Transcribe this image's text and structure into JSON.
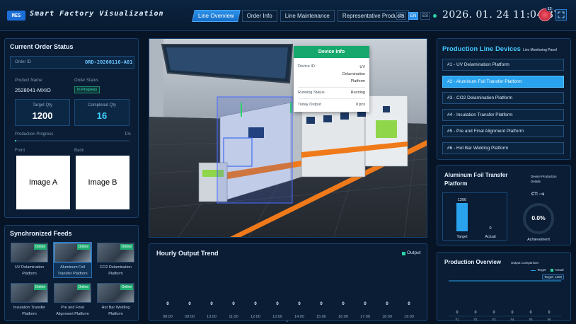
{
  "header": {
    "logo": "MES",
    "title": "Smart Factory Visualization",
    "tabs": [
      {
        "label": "Line Overview",
        "active": true
      },
      {
        "label": "Order Info",
        "active": false
      },
      {
        "label": "Line Maintenance",
        "active": false
      },
      {
        "label": "Representative Products",
        "active": false
      }
    ],
    "languages": [
      {
        "code": "CN",
        "active": false
      },
      {
        "code": "EN",
        "active": true
      },
      {
        "code": "ES",
        "active": false
      }
    ],
    "clock": "2026. 01. 24  11:04:37",
    "alert_count": "12",
    "fullscreen_icon": "expand-icon"
  },
  "order": {
    "title": "Current Order Status",
    "order_id_label": "Order ID",
    "order_id": "ORD-20260116-A01",
    "product_name_label": "Product Name",
    "product_name": "2528041-MXIO",
    "order_status_label": "Order Status",
    "order_status": "In Progress",
    "target_qty_label": "Target Qty",
    "target_qty": "1200",
    "completed_qty_label": "Completed Qty",
    "completed_qty": "16",
    "progress_label": "Production Progress",
    "progress_text": "1%",
    "progress_fraction": 0.01,
    "front_label": "Front",
    "back_label": "Back",
    "image_a": "Image A",
    "image_b": "Image B"
  },
  "feeds": {
    "title": "Synchronized Feeds",
    "online_label": "Online",
    "items": [
      {
        "name1": "UV Delamination",
        "name2": "Platform",
        "active": false
      },
      {
        "name1": "Aluminum Foil",
        "name2": "Transfer Platform",
        "active": true
      },
      {
        "name1": "CO2 Delamination",
        "name2": "Platform",
        "active": false
      },
      {
        "name1": "Insulation Transfer",
        "name2": "Platform",
        "active": false
      },
      {
        "name1": "Pre and Final",
        "name2": "Alignment Platform",
        "active": false
      },
      {
        "name1": "Hot Bar Welding",
        "name2": "Platform",
        "active": false
      }
    ]
  },
  "device_info": {
    "title": "Device Info",
    "device_id_label": "Device ID",
    "device_id": [
      "UV",
      "Delamination",
      "Platform"
    ],
    "running_status_label": "Running Status",
    "running_status": "Running",
    "today_output_label": "Today Output",
    "today_output": "0 pcs"
  },
  "hourly": {
    "title": "Hourly Output Trend",
    "legend": "Output",
    "color": "#2bd3a6"
  },
  "devices": {
    "title": "Production Line Devices",
    "subtitle": "Live Monitoring Panel",
    "items": [
      {
        "label": "#1 - UV Delamination Platform",
        "active": false
      },
      {
        "label": "#2 - Aluminum Foil Transfer Platform",
        "active": true
      },
      {
        "label": "#3 - CO2 Delamination Platform",
        "active": false
      },
      {
        "label": "#4 - Insulation Transfer Platform",
        "active": false
      },
      {
        "label": "#5 - Pre and Final Alignment Platform",
        "active": false
      },
      {
        "label": "#6 - Hot Bar Welding Platform",
        "active": false
      }
    ]
  },
  "detail": {
    "title1": "Aluminum Foil Transfer",
    "title2": "Platform",
    "side1": "Device Production",
    "side2": "Details",
    "ct": "CT: --s",
    "target_val": "1200",
    "actual_val": "0",
    "target_label": "Target",
    "actual_label": "Actual",
    "achievement": "0.0%",
    "achievement_fraction": 0.0,
    "achievement_label": "Achievement"
  },
  "overview": {
    "title": "Production Overview",
    "subtitle": "Output Comparison",
    "legend_target": "Target",
    "legend_actual": "Actual",
    "target_tag": "Target: 1200"
  },
  "chart_data": [
    {
      "type": "bar",
      "title": "Hourly Output Trend",
      "categories": [
        "08:00",
        "09:00",
        "10:00",
        "11:00",
        "12:00",
        "13:00",
        "14:00",
        "15:00",
        "16:00",
        "17:00",
        "18:00",
        "19:00"
      ],
      "series": [
        {
          "name": "Output",
          "values": [
            0,
            0,
            0,
            0,
            0,
            0,
            0,
            0,
            0,
            0,
            0,
            0
          ]
        }
      ],
      "legend": "top-right"
    },
    {
      "type": "bar",
      "title": "Aluminum Foil Transfer Platform",
      "categories": [
        "Target",
        "Actual"
      ],
      "values": [
        1200,
        0
      ]
    },
    {
      "type": "bar",
      "title": "Production Overview",
      "categories": [
        "#1",
        "#2",
        "#3",
        "#4",
        "#5",
        "#6"
      ],
      "series": [
        {
          "name": "Target",
          "values": [
            1200,
            1200,
            1200,
            1200,
            1200,
            1200
          ]
        },
        {
          "name": "Actual",
          "values": [
            0,
            0,
            0,
            0,
            0,
            0
          ]
        }
      ],
      "legend": "top-right"
    }
  ]
}
